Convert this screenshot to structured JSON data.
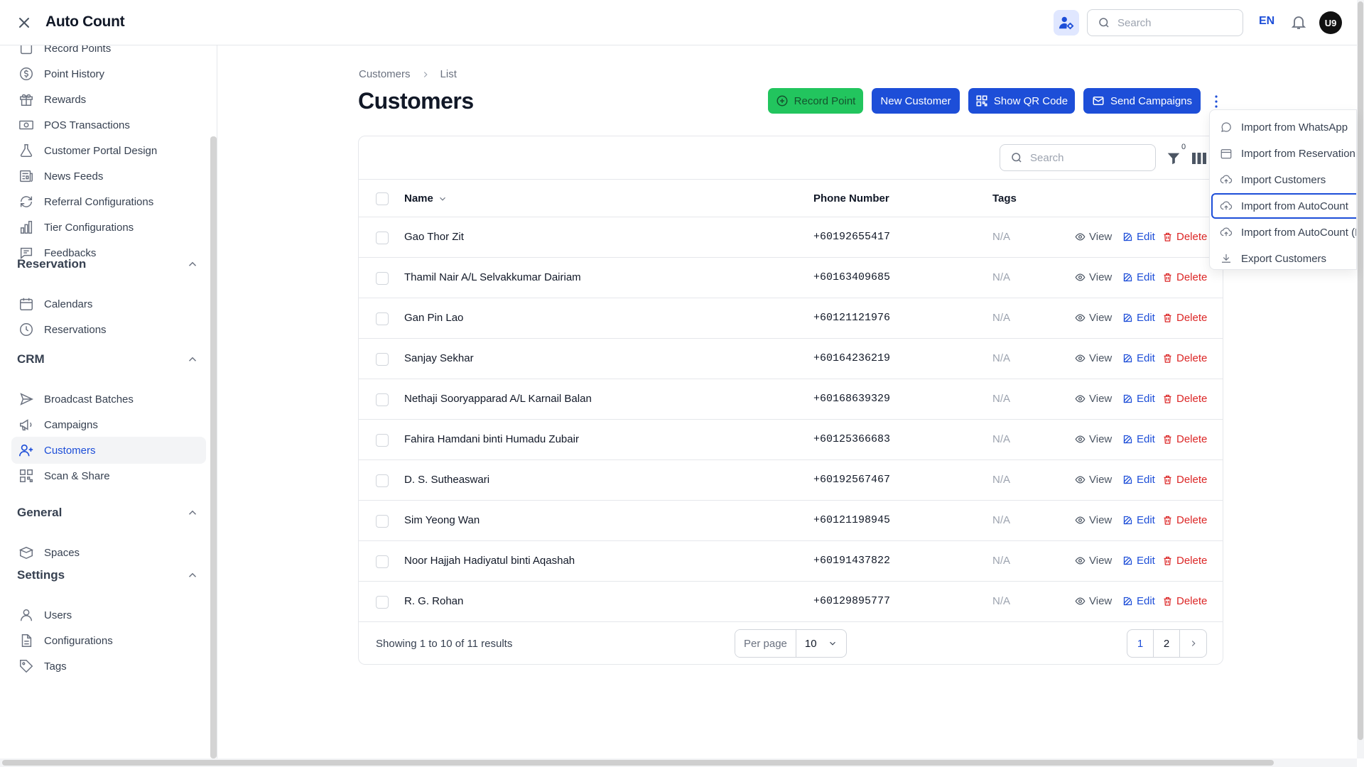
{
  "app": {
    "title": "Auto Count"
  },
  "topbar": {
    "search_placeholder": "Search",
    "language": "EN",
    "avatar_initials": "U9"
  },
  "sidebar": {
    "items": [
      {
        "label": "Record Points",
        "icon": "record-icon"
      },
      {
        "label": "Point History",
        "icon": "dollar-icon"
      },
      {
        "label": "Rewards",
        "icon": "gift-icon"
      },
      {
        "label": "POS Transactions",
        "icon": "money-icon"
      },
      {
        "label": "Customer Portal Design",
        "icon": "flask-icon"
      },
      {
        "label": "News Feeds",
        "icon": "newspaper-icon"
      },
      {
        "label": "Referral Configurations",
        "icon": "refresh-icon"
      },
      {
        "label": "Tier Configurations",
        "icon": "bar-chart-icon"
      },
      {
        "label": "Feedbacks",
        "icon": "chat-icon"
      }
    ],
    "sections": {
      "reservation": {
        "title": "Reservation",
        "items": [
          {
            "label": "Calendars"
          },
          {
            "label": "Reservations"
          }
        ]
      },
      "crm": {
        "title": "CRM",
        "items": [
          {
            "label": "Broadcast Batches"
          },
          {
            "label": "Campaigns"
          },
          {
            "label": "Customers"
          },
          {
            "label": "Scan & Share"
          }
        ]
      },
      "general": {
        "title": "General",
        "items": [
          {
            "label": "Spaces"
          }
        ]
      },
      "settings": {
        "title": "Settings",
        "items": [
          {
            "label": "Users"
          },
          {
            "label": "Configurations"
          },
          {
            "label": "Tags"
          }
        ]
      }
    }
  },
  "breadcrumb": {
    "parent": "Customers",
    "current": "List"
  },
  "page": {
    "title": "Customers"
  },
  "actions": {
    "record_point": "Record Point",
    "new_customer": "New Customer",
    "show_qr": "Show QR Code",
    "send_campaigns": "Send Campaigns"
  },
  "dropdown": {
    "items": [
      {
        "label": "Import from WhatsApp",
        "icon": "whatsapp-icon"
      },
      {
        "label": "Import from Reservation",
        "icon": "calendar-icon"
      },
      {
        "label": "Import Customers",
        "icon": "cloud-upload-icon"
      },
      {
        "label": "Import from AutoCount",
        "icon": "cloud-upload-icon"
      },
      {
        "label": "Import from AutoCount (B",
        "icon": "cloud-upload-icon"
      },
      {
        "label": "Export Customers",
        "icon": "download-icon"
      }
    ]
  },
  "table": {
    "search_placeholder": "Search",
    "filter_count": "0",
    "columns": {
      "name": "Name",
      "phone": "Phone Number",
      "tags": "Tags"
    },
    "row_actions": {
      "view": "View",
      "edit": "Edit",
      "delete": "Delete"
    },
    "rows": [
      {
        "name": "Gao Thor Zit",
        "phone": "+60192655417",
        "tags": "N/A"
      },
      {
        "name": "Thamil Nair A/L Selvakkumar Dairiam",
        "phone": "+60163409685",
        "tags": "N/A"
      },
      {
        "name": "Gan Pin Lao",
        "phone": "+60121121976",
        "tags": "N/A"
      },
      {
        "name": "Sanjay Sekhar",
        "phone": "+60164236219",
        "tags": "N/A"
      },
      {
        "name": "Nethaji Sooryapparad A/L Karnail Balan",
        "phone": "+60168639329",
        "tags": "N/A"
      },
      {
        "name": "Fahira Hamdani binti Humadu Zubair",
        "phone": "+60125366683",
        "tags": "N/A"
      },
      {
        "name": "D. S. Sutheaswari",
        "phone": "+60192567467",
        "tags": "N/A"
      },
      {
        "name": "Sim Yeong Wan",
        "phone": "+60121198945",
        "tags": "N/A"
      },
      {
        "name": "Noor Hajjah Hadiyatul binti Aqashah",
        "phone": "+60191437822",
        "tags": "N/A"
      },
      {
        "name": "R. G. Rohan",
        "phone": "+60129895777",
        "tags": "N/A"
      }
    ],
    "footer": {
      "summary": "Showing 1 to 10 of 11 results",
      "per_page_label": "Per page",
      "per_page_value": "10",
      "pages": [
        "1",
        "2"
      ]
    }
  },
  "colors": {
    "primary": "#1d4ed8",
    "success": "#22c55e",
    "danger": "#dc2626"
  }
}
